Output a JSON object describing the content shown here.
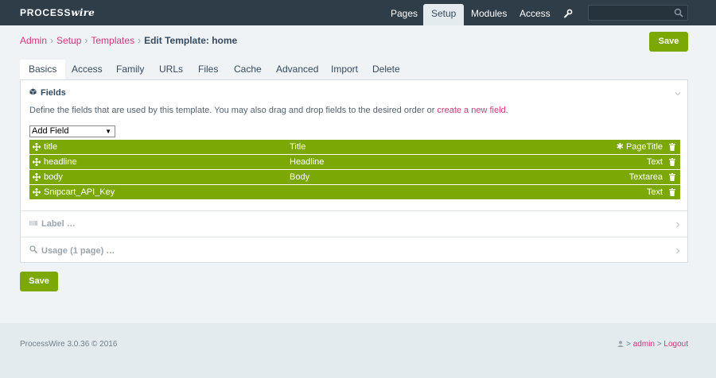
{
  "app": {
    "logo_prefix": "PROCESS",
    "logo_suffix": "wire"
  },
  "topnav": [
    {
      "label": "Pages",
      "active": false
    },
    {
      "label": "Setup",
      "active": true
    },
    {
      "label": "Modules",
      "active": false
    },
    {
      "label": "Access",
      "active": false
    }
  ],
  "search": {
    "placeholder": ""
  },
  "breadcrumb": {
    "items": [
      "Admin",
      "Setup",
      "Templates"
    ],
    "current": "Edit Template: home"
  },
  "save_label": "Save",
  "tabs": [
    "Basics",
    "Access",
    "Family",
    "URLs",
    "Files",
    "Cache",
    "Advanced",
    "Import",
    "Delete"
  ],
  "fields_section": {
    "title": "Fields",
    "description": "Define the fields that are used by this template. You may also drag and drop fields to the desired order or ",
    "description_link": "create a new field",
    "description_end": ".",
    "add_field": "Add Field",
    "rows": [
      {
        "name": "title",
        "label": "Title",
        "type": "PageTitle",
        "gear": true
      },
      {
        "name": "headline",
        "label": "Headline",
        "type": "Text",
        "gear": false
      },
      {
        "name": "body",
        "label": "Body",
        "type": "Textarea",
        "gear": false
      },
      {
        "name": "Snipcart_API_Key",
        "label": "",
        "type": "Text",
        "gear": false
      }
    ]
  },
  "label_section": {
    "title": "Label …"
  },
  "usage_section": {
    "title": "Usage (1 page) …"
  },
  "footer": {
    "copyright": "ProcessWire 3.0.36 © 2016",
    "user": "admin",
    "logout": "Logout",
    "sep": ">"
  },
  "colors": {
    "accent": "#7ba804",
    "link": "#d2387b",
    "nav_bg": "#2f3d49"
  }
}
